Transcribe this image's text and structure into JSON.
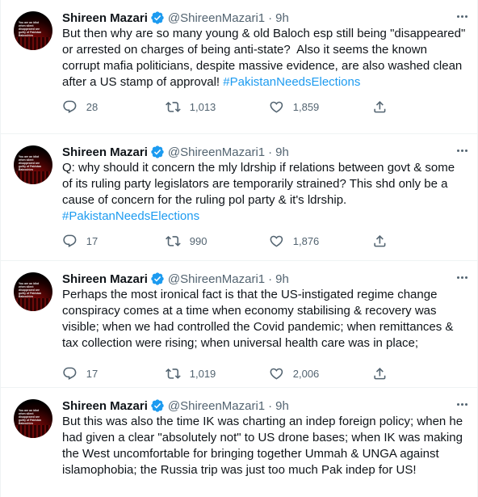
{
  "colors": {
    "accent": "#1d9bf0",
    "text": "#0f1419",
    "muted": "#536471",
    "divider": "#eff3f4"
  },
  "tweets": [
    {
      "name": "Shireen Mazari",
      "handle": "@ShireenMazari1",
      "dot": "·",
      "time": "9h",
      "avatar_text": "You are an idiot when silent disappeared are guilty of Pakistan Baloochies",
      "text": "But then why are so many young & old Baloch esp still being \"disappeared\" or arrested on charges of being anti-state?  Also it seems the known corrupt mafia politicians, despite massive evidence, are also washed clean after a US stamp of approval! ",
      "hashtag": "#PakistanNeedsElections",
      "replies": "28",
      "retweets": "1,013",
      "likes": "1,859"
    },
    {
      "name": "Shireen Mazari",
      "handle": "@ShireenMazari1",
      "dot": "·",
      "time": "9h",
      "avatar_text": "You are an idiot when silent disappeared are guilty of Pakistan Baloochies",
      "text": "Q: why should it concern the mly ldrship if relations between govt & some of its ruling party legislators are temporarily strained? This shd only be a cause of concern for the ruling pol party & it's ldrship. ",
      "hashtag": "#PakistanNeedsElections",
      "replies": "17",
      "retweets": "990",
      "likes": "1,876"
    },
    {
      "name": "Shireen Mazari",
      "handle": "@ShireenMazari1",
      "dot": "·",
      "time": "9h",
      "avatar_text": "You are an idiot when silent disappeared are guilty of Pakistan Baloochies",
      "text": "Perhaps the most ironical fact is that the US-instigated regime change conspiracy comes at a time when economy stabilising & recovery was visible; when we had controlled the Covid pandemic; when remittances & tax collection were rising; when universal health care was in place;",
      "hashtag": "",
      "replies": "17",
      "retweets": "1,019",
      "likes": "2,006"
    },
    {
      "name": "Shireen Mazari",
      "handle": "@ShireenMazari1",
      "dot": "·",
      "time": "9h",
      "avatar_text": "You are an idiot when silent disappeared are guilty of Pakistan Baloochies",
      "text": "But this was also the time IK was charting an indep foreign policy; when he had given a clear \"absolutely not\" to US drone bases; when IK was making the West uncomfortable for bringing together Ummah & UNGA against islamophobia; the Russia trip was just too much Pak indep for US!",
      "hashtag": "",
      "replies": "",
      "retweets": "",
      "likes": ""
    }
  ]
}
